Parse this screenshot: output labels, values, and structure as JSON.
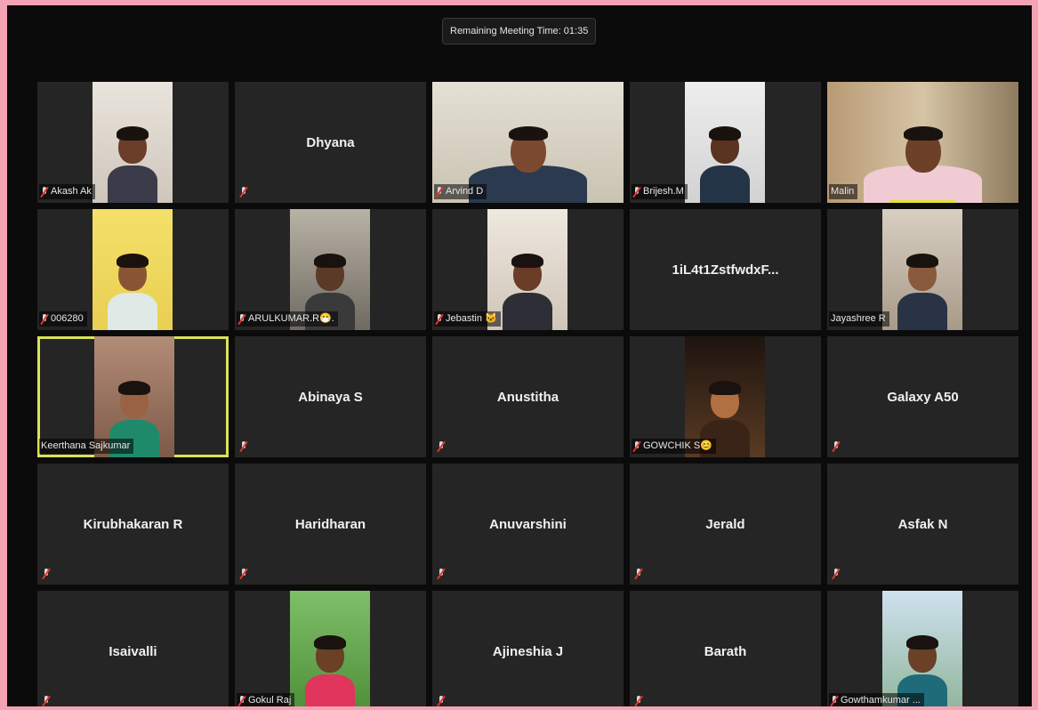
{
  "meeting": {
    "remaining_time": "Remaining Meeting Time: 01:35"
  },
  "colors": {
    "background": "#0b0b0b",
    "tile": "#252525",
    "active_border": "#d9e35a",
    "mute_red": "#e0342f",
    "frame": "#f4a3b4"
  },
  "participants": [
    {
      "name": "Akash Ak",
      "video": true,
      "muted": true
    },
    {
      "name": "Dhyana",
      "video": false,
      "muted": true
    },
    {
      "name": "Arvind D",
      "video": true,
      "muted": true
    },
    {
      "name": "Brijesh.M",
      "video": true,
      "muted": true
    },
    {
      "name": "Malin",
      "video": true,
      "muted": false,
      "speaking": true
    },
    {
      "name": "006280",
      "video": true,
      "muted": true
    },
    {
      "name": "ARULKUMAR.R😷.",
      "video": true,
      "muted": true
    },
    {
      "name": "Jebastin 🐱",
      "video": true,
      "muted": true
    },
    {
      "name": "1iL4t1ZstfwdxF...",
      "video": false,
      "muted": false
    },
    {
      "name": "Jayashree R",
      "video": true,
      "muted": false
    },
    {
      "name": "Keerthana Sajkumar",
      "video": true,
      "muted": false,
      "active": true
    },
    {
      "name": "Abinaya S",
      "video": false,
      "muted": true
    },
    {
      "name": "Anustitha",
      "video": false,
      "muted": true
    },
    {
      "name": "GOWCHIK S😊",
      "video": true,
      "muted": true
    },
    {
      "name": "Galaxy A50",
      "video": false,
      "muted": true
    },
    {
      "name": "Kirubhakaran R",
      "video": false,
      "muted": true
    },
    {
      "name": "Haridharan",
      "video": false,
      "muted": true
    },
    {
      "name": "Anuvarshini",
      "video": false,
      "muted": true
    },
    {
      "name": "Jerald",
      "video": false,
      "muted": true
    },
    {
      "name": "Asfak N",
      "video": false,
      "muted": true
    },
    {
      "name": "Isaivalli",
      "video": false,
      "muted": true
    },
    {
      "name": "Gokul Raj",
      "video": true,
      "muted": true
    },
    {
      "name": "Ajineshia J",
      "video": false,
      "muted": true
    },
    {
      "name": "Barath",
      "video": false,
      "muted": true
    },
    {
      "name": "Gowthamkumar ...",
      "video": true,
      "muted": true
    }
  ]
}
